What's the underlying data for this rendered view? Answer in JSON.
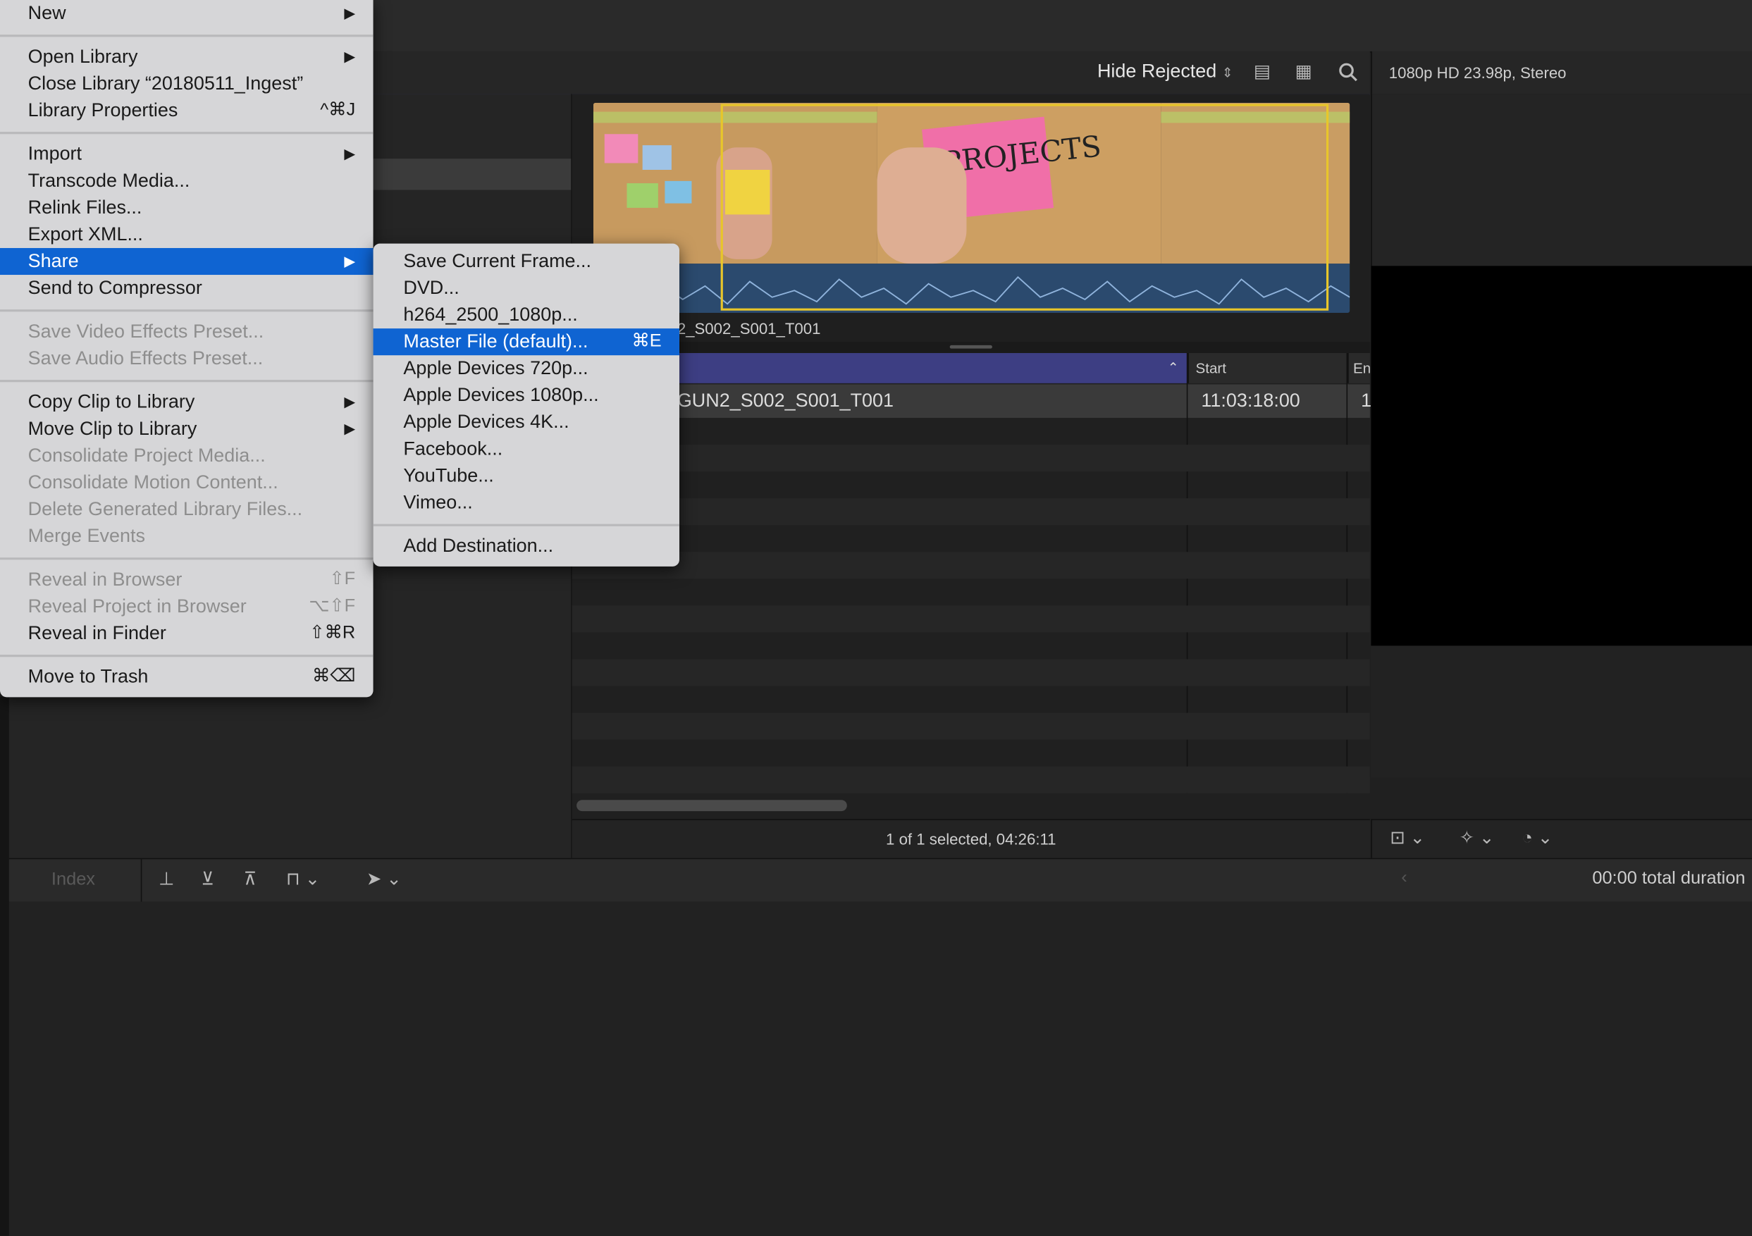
{
  "browser": {
    "filter_label": "Hide Rejected",
    "clip_label": "2_S002_S001_T001",
    "column_start": "Start",
    "column_end": "En",
    "row_name": "GUN2_S002_S001_T001",
    "row_start": "11:03:18:00",
    "row_end": "1",
    "status": "1 of 1 selected, 04:26:11"
  },
  "inspector": {
    "format": "1080p HD 23.98p, Stereo"
  },
  "timeline": {
    "index_label": "Index",
    "duration": "00:00 total duration"
  },
  "file_menu": {
    "items": [
      {
        "label": "New",
        "submenu": true
      },
      {
        "label": "Open Library",
        "submenu": true
      },
      {
        "label": "Close Library “20180511_Ingest”"
      },
      {
        "label": "Library Properties",
        "shortcut": "^⌘J"
      },
      {
        "label": "Import",
        "submenu": true
      },
      {
        "label": "Transcode Media..."
      },
      {
        "label": "Relink Files..."
      },
      {
        "label": "Export XML..."
      },
      {
        "label": "Share",
        "submenu": true,
        "highlighted": true
      },
      {
        "label": "Send to Compressor"
      },
      {
        "label": "Save Video Effects Preset...",
        "disabled": true
      },
      {
        "label": "Save Audio Effects Preset...",
        "disabled": true
      },
      {
        "label": "Copy Clip to Library",
        "submenu": true
      },
      {
        "label": "Move Clip to Library",
        "submenu": true
      },
      {
        "label": "Consolidate Project Media...",
        "disabled": true
      },
      {
        "label": "Consolidate Motion Content...",
        "disabled": true
      },
      {
        "label": "Delete Generated Library Files...",
        "disabled": true
      },
      {
        "label": "Merge Events",
        "disabled": true
      },
      {
        "label": "Reveal in Browser",
        "shortcut": "⇧F",
        "disabled": true
      },
      {
        "label": "Reveal Project in Browser",
        "shortcut": "⌥⇧F",
        "disabled": true
      },
      {
        "label": "Reveal in Finder",
        "shortcut": "⇧⌘R"
      },
      {
        "label": "Move to Trash",
        "shortcut": "⌘⌫"
      }
    ]
  },
  "share_menu": {
    "items": [
      {
        "label": "Save Current Frame..."
      },
      {
        "label": "DVD..."
      },
      {
        "label": "h264_2500_1080p..."
      },
      {
        "label": "Master File (default)...",
        "shortcut": "⌘E",
        "highlighted": true
      },
      {
        "label": "Apple Devices 720p..."
      },
      {
        "label": "Apple Devices 1080p..."
      },
      {
        "label": "Apple Devices 4K..."
      },
      {
        "label": "Facebook..."
      },
      {
        "label": "YouTube..."
      },
      {
        "label": "Vimeo..."
      },
      {
        "label": "Add Destination..."
      }
    ]
  },
  "icons": {
    "submenu_arrow": "triangle-right-icon",
    "sort": "chevron-up-icon",
    "search": "search-icon"
  },
  "colors": {
    "highlight": "#0f64d2",
    "playhead_range": "#e8c62a",
    "list_header": "#3d3e83"
  }
}
